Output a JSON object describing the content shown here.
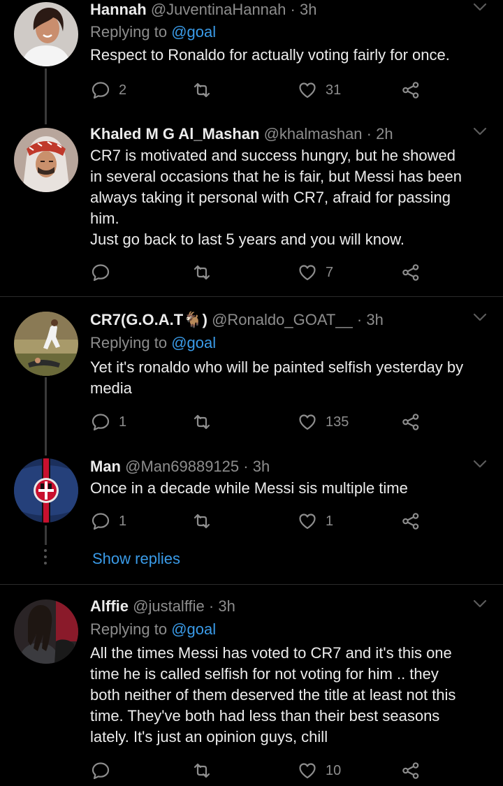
{
  "tweets": [
    {
      "name": "Hannah",
      "handle": "@JuventinaHannah",
      "time": "3h",
      "replying_prefix": "Replying to ",
      "replying_to": "@goal",
      "text": "Respect to Ronaldo for actually voting fairly for once.",
      "replies": "2",
      "retweets": "",
      "likes": "31"
    },
    {
      "name": "Khaled M G Al_Mashan",
      "handle": "@khalmashan",
      "time": "2h",
      "text_lines": [
        "CR7 is motivated and success hungry, but he showed",
        "in several occasions that he is fair, but Messi has been",
        "always taking it personal with CR7, afraid for passing",
        "him.",
        "Just go back to last 5 years and you will know."
      ],
      "replies": "",
      "retweets": "",
      "likes": "7"
    },
    {
      "name": "CR7(G.O.A.T🐐)",
      "handle": "@Ronaldo_GOAT__",
      "time": "3h",
      "replying_prefix": "Replying to ",
      "replying_to": "@goal",
      "text_lines": [
        "Yet it's ronaldo who will be painted selfish yesterday by",
        "media"
      ],
      "replies": "1",
      "retweets": "",
      "likes": "135"
    },
    {
      "name": "Man",
      "handle": "@Man69889125",
      "time": "3h",
      "text": "Once in a decade while Messi sis multiple time",
      "replies": "1",
      "retweets": "",
      "likes": "1",
      "show_replies": "Show replies"
    },
    {
      "name": "Alffie",
      "handle": "@justalffie",
      "time": "3h",
      "replying_prefix": "Replying to ",
      "replying_to": "@goal",
      "text_lines": [
        "All the times Messi has voted to CR7 and it's this one",
        "time he is called selfish for not voting for him .. they",
        "both neither of them deserved the title at least not this",
        "time. They've both had less than their best seasons",
        "lately. It's just an opinion guys, chill"
      ],
      "replies": "",
      "retweets": "",
      "likes": "10"
    }
  ],
  "separator": " · ",
  "icons": {
    "reply": "reply-icon",
    "retweet": "retweet-icon",
    "like": "heart-icon",
    "share": "share-icon",
    "more": "chevron-down-icon"
  },
  "colors": {
    "background": "#000000",
    "text": "#ececec",
    "muted": "#8d8d8d",
    "link": "#3a9be8",
    "divider": "#2b2b2b"
  }
}
